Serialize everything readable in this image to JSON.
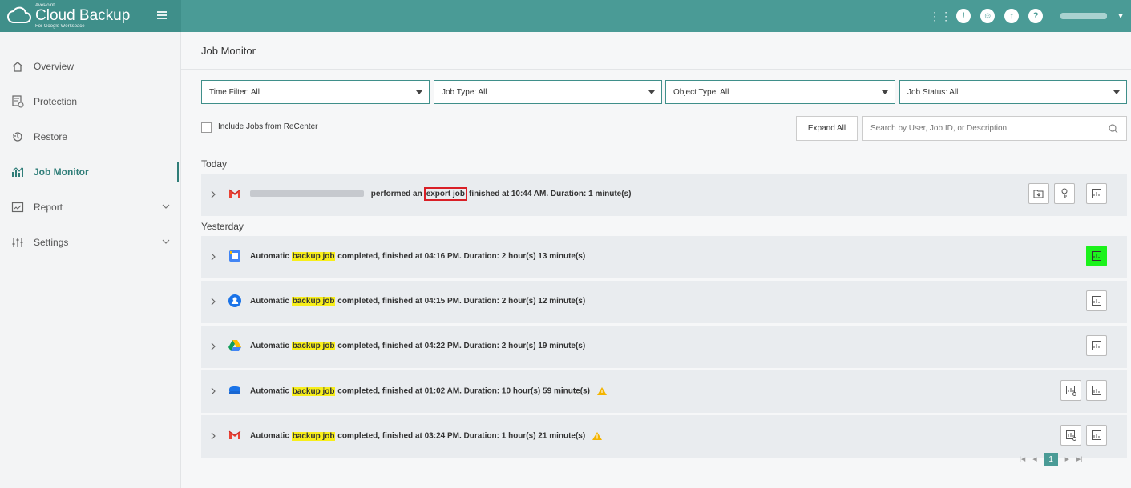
{
  "brand": {
    "vendor": "AvePoint",
    "name": "Cloud Backup",
    "subtitle": "For Google Workspace"
  },
  "header": {
    "icons": [
      "apps-grid-icon",
      "notification-icon",
      "feedback-icon",
      "notification-bell-icon",
      "help-icon"
    ]
  },
  "sidebar": {
    "items": [
      {
        "label": "Overview",
        "icon": "home-icon"
      },
      {
        "label": "Protection",
        "icon": "protection-icon"
      },
      {
        "label": "Restore",
        "icon": "restore-icon"
      },
      {
        "label": "Job Monitor",
        "icon": "job-monitor-icon",
        "active": true
      },
      {
        "label": "Report",
        "icon": "report-icon",
        "has_chevron": true
      },
      {
        "label": "Settings",
        "icon": "settings-icon",
        "has_chevron": true
      }
    ]
  },
  "main": {
    "title": "Job Monitor",
    "filters": [
      {
        "label": "Time Filter: All"
      },
      {
        "label": "Job Type: All"
      },
      {
        "label": "Object Type: All"
      },
      {
        "label": "Job Status: All"
      }
    ],
    "include_label": "Include Jobs from ReCenter",
    "expand_label": "Expand All",
    "search_placeholder": "Search by User, Job ID, or Description",
    "sections": {
      "today": "Today",
      "yesterday": "Yesterday"
    },
    "jobs": [
      {
        "service": "gmail",
        "part1": "performed an",
        "highlight": "export job",
        "part2": "finished at 10:44 AM. Duration: 1 minute(s)"
      },
      {
        "service": "calendar",
        "part1": "Automatic",
        "highlight": "backup job",
        "part2": "completed, finished at 04:16 PM. Duration: 2 hour(s) 13 minute(s)"
      },
      {
        "service": "contacts",
        "part1": "Automatic",
        "highlight": "backup job",
        "part2": "completed, finished at 04:15 PM. Duration: 2 hour(s) 12 minute(s)"
      },
      {
        "service": "drive",
        "part1": "Automatic",
        "highlight": "backup job",
        "part2": "completed, finished at 04:22 PM. Duration: 2 hour(s) 19 minute(s)"
      },
      {
        "service": "shared-drive",
        "part1": "Automatic",
        "highlight": "backup job",
        "part2": "completed, finished at 01:02 AM. Duration: 10 hour(s) 59 minute(s)"
      },
      {
        "service": "gmail",
        "part1": "Automatic",
        "highlight": "backup job",
        "part2": "completed, finished at 03:24 PM. Duration: 1 hour(s) 21 minute(s)"
      }
    ],
    "pagination": {
      "current_page": "1"
    }
  },
  "colors": {
    "teal": "#4a9b96",
    "highlight": "#f7ee1a",
    "export_box": "#d91f26",
    "green_button": "#1bf21b"
  }
}
